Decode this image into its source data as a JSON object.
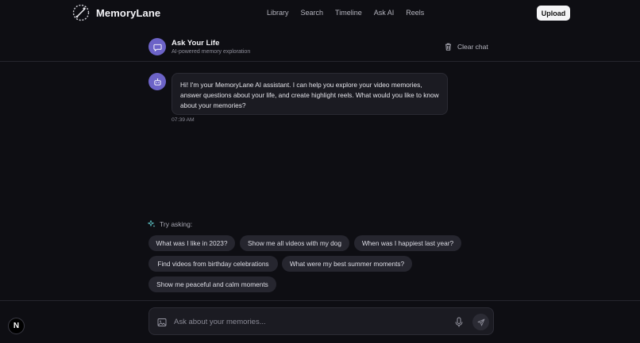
{
  "brand": {
    "name": "MemoryLane",
    "logo_icon": "sparkle-film-icon"
  },
  "nav": {
    "items": [
      "Library",
      "Search",
      "Timeline",
      "Ask AI",
      "Reels"
    ],
    "upload_label": "Upload"
  },
  "chat_header": {
    "title": "Ask Your Life",
    "subtitle": "AI-powered memory exploration",
    "clear_label": "Clear chat",
    "avatar_icon": "chat-bubble-icon",
    "clear_icon": "trash-icon"
  },
  "messages": [
    {
      "sender": "assistant",
      "avatar_icon": "robot-icon",
      "text": "Hi! I'm your MemoryLane AI assistant. I can help you explore your video memories, answer questions about your life, and create highlight reels. What would you like to know about your memories?",
      "time": "07:39 AM"
    }
  ],
  "suggestions": {
    "heading": "Try asking:",
    "icon": "sparkles-icon",
    "chips": [
      "What was I like in 2023?",
      "Show me all videos with my dog",
      "When was I happiest last year?",
      "Find videos from birthday celebrations",
      "What were my best summer moments?",
      "Show me peaceful and calm moments"
    ]
  },
  "composer": {
    "placeholder": "Ask about your memories...",
    "value": "",
    "image_icon": "image-icon",
    "mic_icon": "microphone-icon",
    "send_icon": "send-icon"
  },
  "dev_badge": {
    "label": "N"
  },
  "colors": {
    "background": "#0e0e13",
    "accent": "#6c63c7",
    "surface": "#1b1b22",
    "chip": "#26262f"
  }
}
